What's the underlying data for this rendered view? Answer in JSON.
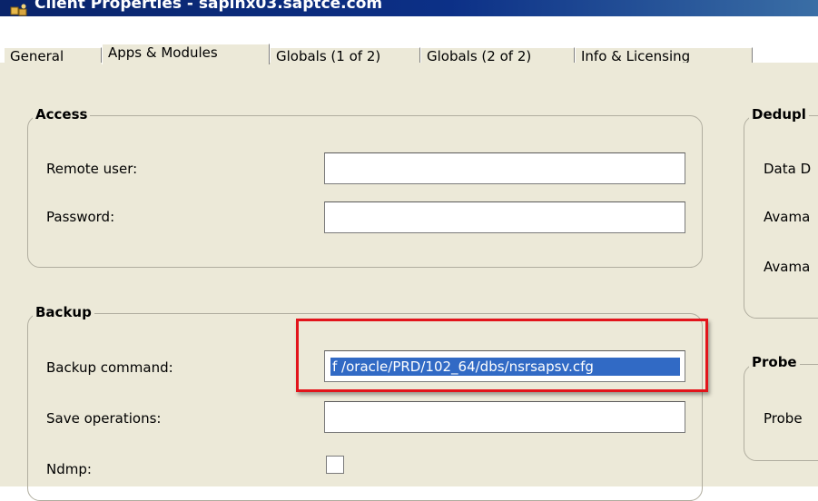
{
  "window": {
    "title": "Client Properties - sapinx03.saptce.com",
    "icon": "client-app-icon"
  },
  "tabs": [
    {
      "label": "General",
      "active": false
    },
    {
      "label": "Apps & Modules",
      "active": true
    },
    {
      "label": "Globals (1 of 2)",
      "active": false
    },
    {
      "label": "Globals (2 of 2)",
      "active": false
    },
    {
      "label": "Info & Licensing",
      "active": false
    }
  ],
  "access": {
    "title": "Access",
    "remote_user_label": "Remote user:",
    "remote_user_value": "",
    "password_label": "Password:",
    "password_value": ""
  },
  "backup": {
    "title": "Backup",
    "backup_command_label": "Backup command:",
    "backup_command_value": "f /oracle/PRD/102_64/dbs/nsrsapsv.cfg",
    "save_operations_label": "Save operations:",
    "save_operations_value": "",
    "ndmp_label": "Ndmp:",
    "ndmp_checked": false
  },
  "dedup": {
    "title": "Dedupl",
    "rows": [
      "Data D",
      "Avama",
      "Avama"
    ]
  },
  "probe": {
    "title": "Probe",
    "rows": [
      "Probe"
    ]
  },
  "colors": {
    "highlight": "#e2141b",
    "selection": "#316ac5",
    "titlebar": "#0a246a"
  }
}
